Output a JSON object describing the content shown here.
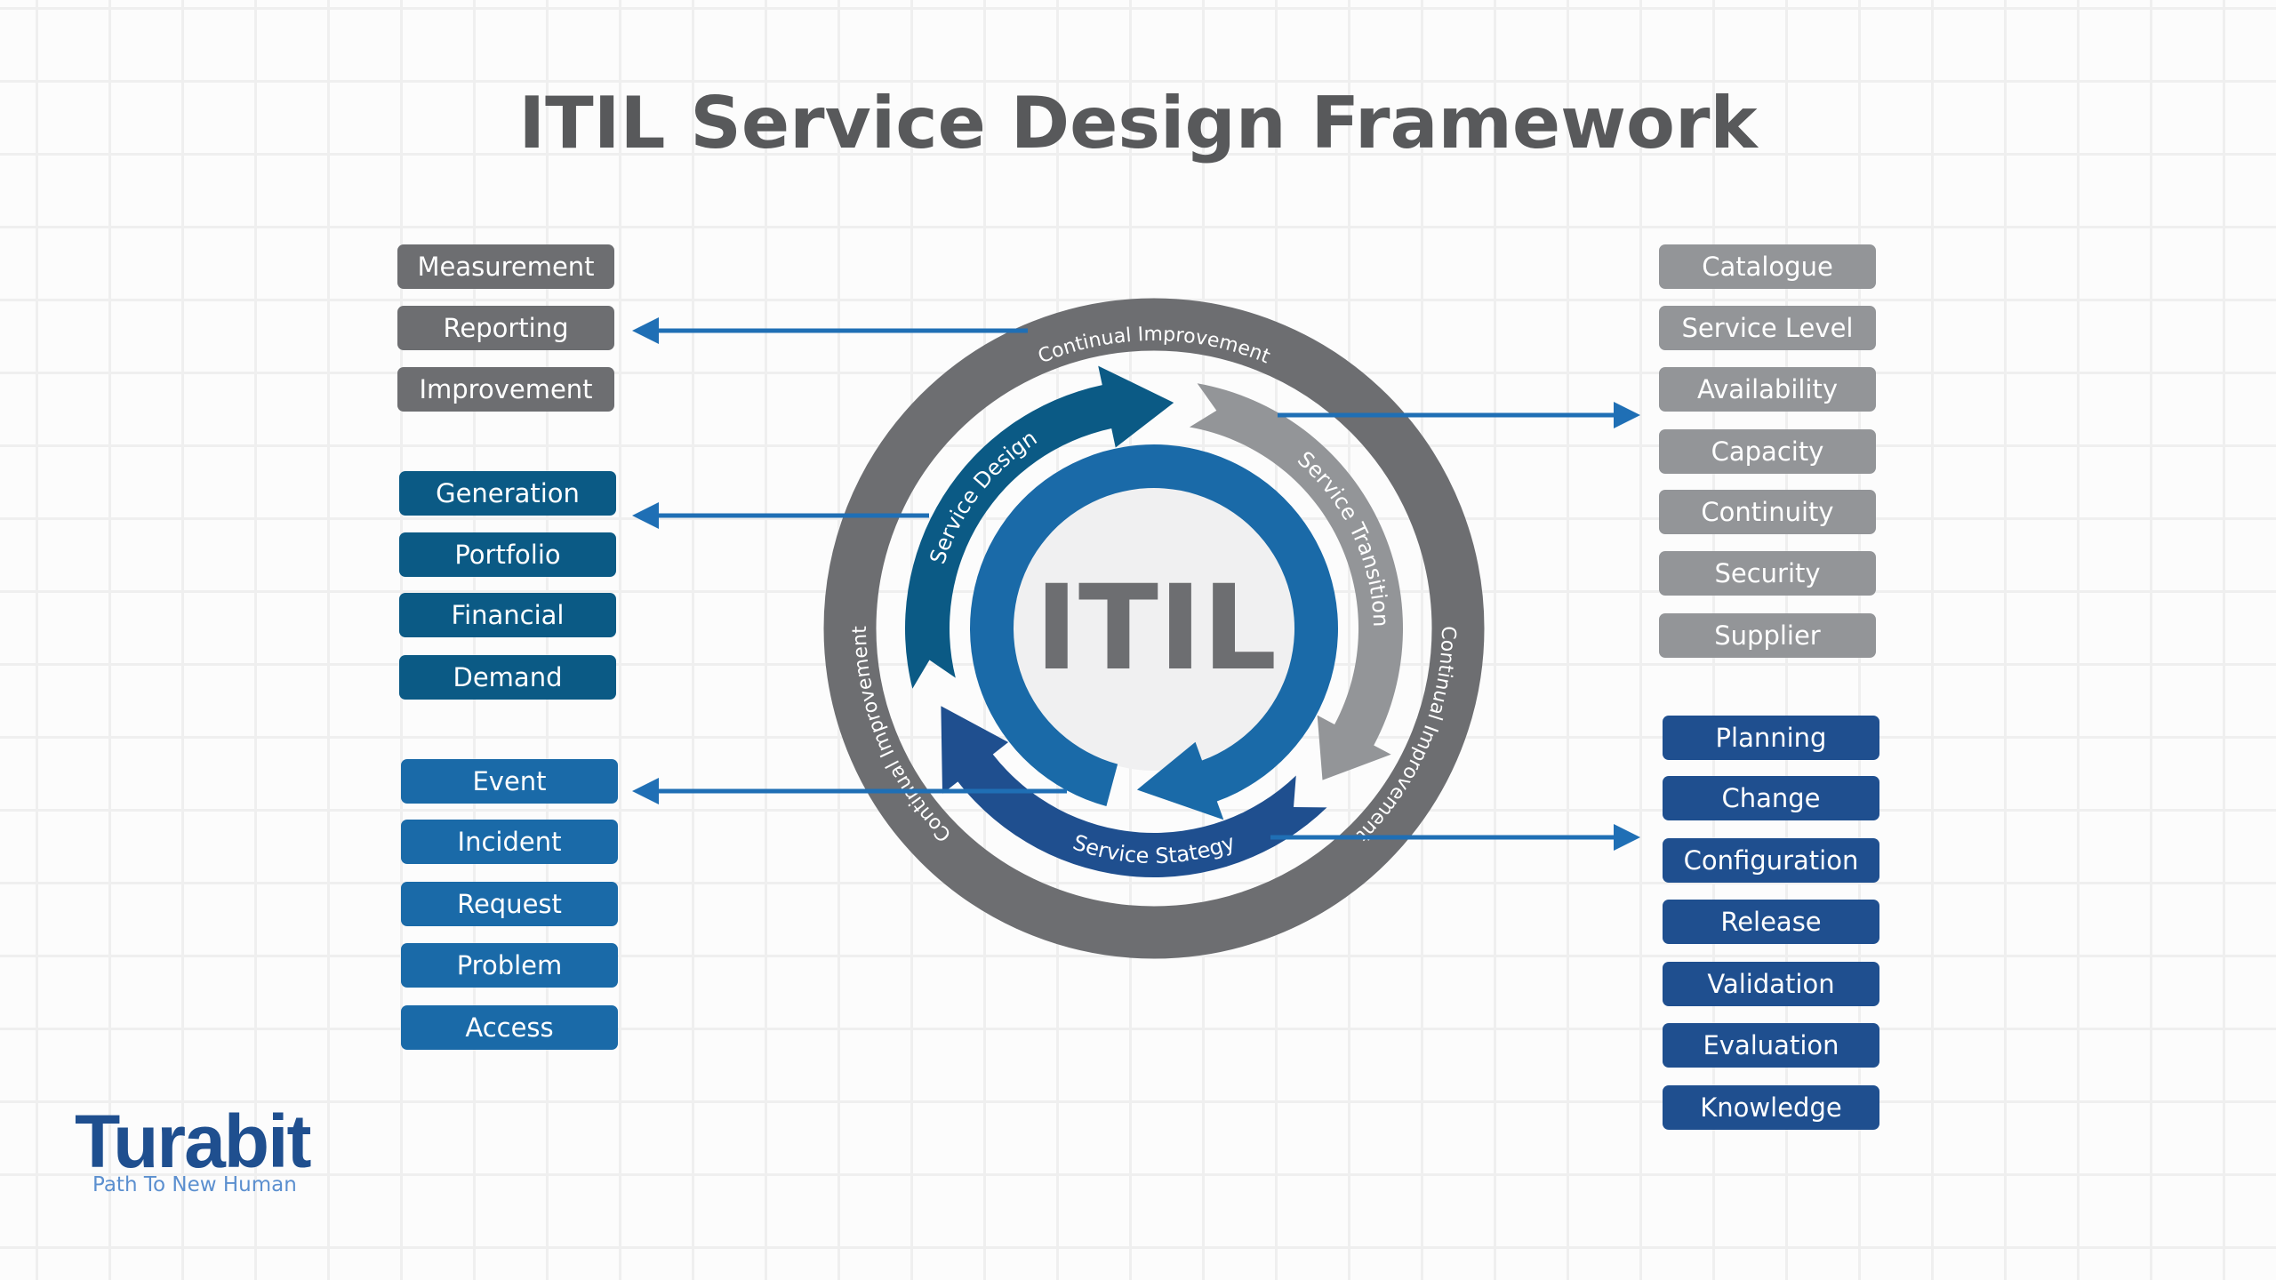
{
  "title": "ITIL Service Design Framework",
  "colors": {
    "grey_box": "#6d6e71",
    "light_grey_box": "#939598",
    "teal_box": "#0b5a85",
    "blue_box": "#1a6aa8",
    "navy_box": "#1f4f8f",
    "connector": "#1f6fb5",
    "outer_ring": "#6d6e71",
    "center_fill": "#f0f0f1"
  },
  "left_groups": [
    {
      "color_key": "grey_box",
      "items": [
        "Measurement",
        "Reporting",
        "Improvement"
      ]
    },
    {
      "color_key": "teal_box",
      "items": [
        "Generation",
        "Portfolio",
        "Financial",
        "Demand"
      ]
    },
    {
      "color_key": "blue_box",
      "items": [
        "Event",
        "Incident",
        "Request",
        "Problem",
        "Access"
      ]
    }
  ],
  "right_groups": [
    {
      "color_key": "light_grey_box",
      "items": [
        "Catalogue",
        "Service Level",
        "Availability",
        "Capacity",
        "Continuity",
        "Security",
        "Supplier"
      ]
    },
    {
      "color_key": "navy_box",
      "items": [
        "Planning",
        "Change",
        "Configuration",
        "Release",
        "Validation",
        "Evaluation",
        "Knowledge"
      ]
    }
  ],
  "diagram": {
    "center_label": "ITIL",
    "outer_ring_label": "Continual Improvement",
    "stages": {
      "design": "Service Design",
      "transition": "Service Transition",
      "strategy": "Service Stategy"
    }
  },
  "logo": {
    "brand": "Turabit",
    "tagline": "Path To New Human"
  }
}
